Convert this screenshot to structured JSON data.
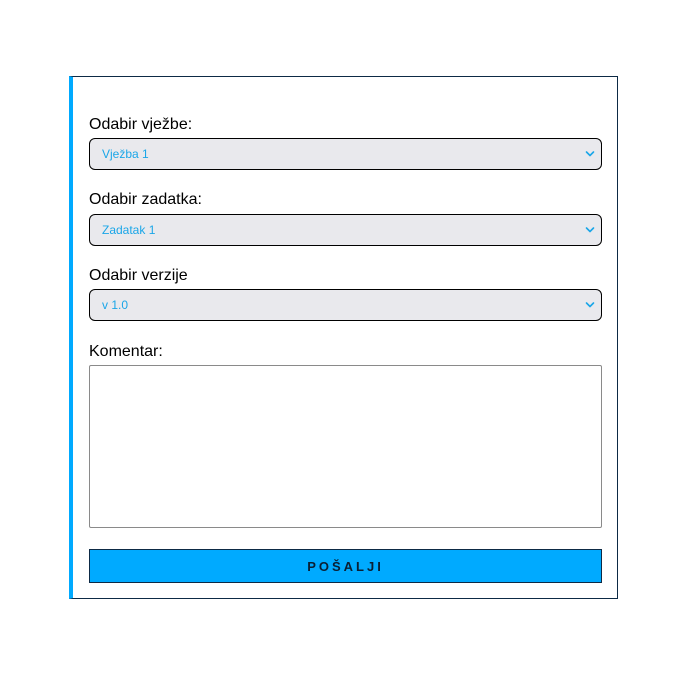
{
  "form": {
    "exercise": {
      "label": "Odabir vježbe:",
      "selected": "Vježba 1"
    },
    "task": {
      "label": "Odabir zadatka:",
      "selected": "Zadatak 1"
    },
    "version": {
      "label": "Odabir verzije",
      "selected": "v 1.0"
    },
    "comment": {
      "label": "Komentar:",
      "value": ""
    },
    "submit_label": "POŠALJI"
  },
  "colors": {
    "accent": "#00aaff",
    "select_text": "#1aa6e8",
    "border_dark": "#0d2a45"
  },
  "icons": {
    "select_arrow": "chevron-down-icon"
  }
}
